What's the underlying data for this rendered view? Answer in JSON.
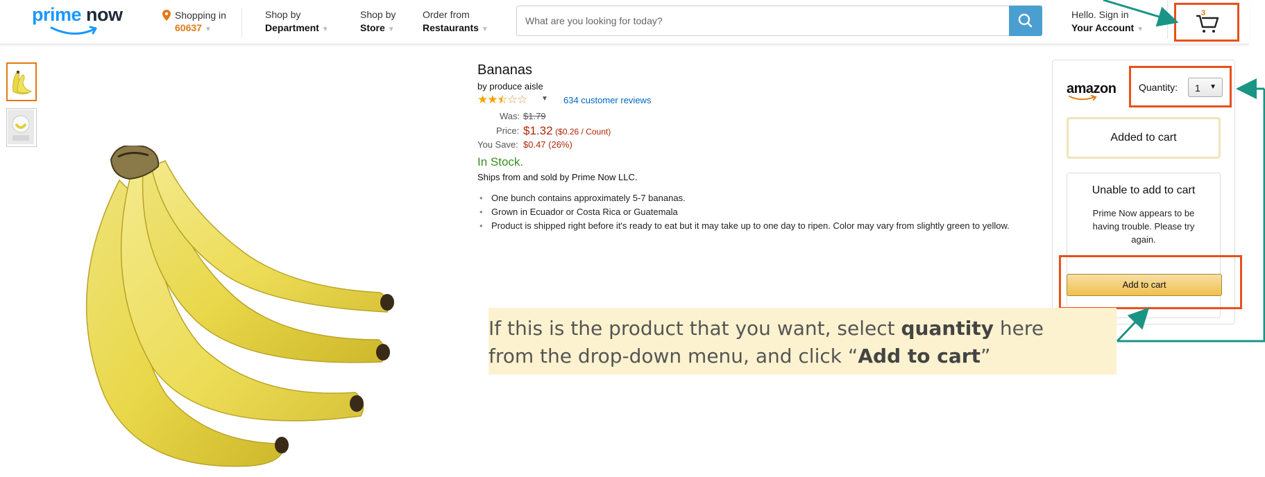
{
  "header": {
    "logo": {
      "prime": "prime",
      "now": "now"
    },
    "location": {
      "label": "Shopping in",
      "zip": "60637"
    },
    "nav": [
      {
        "line1": "Shop by",
        "line2": "Department"
      },
      {
        "line1": "Shop by",
        "line2": "Store"
      },
      {
        "line1": "Order from",
        "line2": "Restaurants"
      }
    ],
    "search": {
      "placeholder": "What are you looking for today?"
    },
    "account": {
      "line1": "Hello. Sign in",
      "line2": "Your Account"
    },
    "cart": {
      "count": "3"
    }
  },
  "product": {
    "title": "Bananas",
    "by": "by produce aisle",
    "rating": {
      "stars": 2.5,
      "reviews": "634 customer reviews"
    },
    "was_label": "Was:",
    "was": "$1.79",
    "price_label": "Price:",
    "price": "$1.32",
    "per_unit": "($0.26 / Count)",
    "save_label": "You Save:",
    "save": "$0.47 (26%)",
    "stock": "In Stock.",
    "ships": "Ships from and sold by Prime Now LLC.",
    "bullets": [
      "One bunch contains approximately 5-7 bananas.",
      "Grown in Ecuador or Costa Rica or Guatemala",
      "Product is shipped right before it's ready to eat but it may take up to one day to ripen. Color may vary from slightly green to yellow."
    ]
  },
  "buybox": {
    "brand": "amazon",
    "quantity_label": "Quantity:",
    "quantity_value": "1",
    "added": "Added to cart",
    "unable_title": "Unable to add to cart",
    "unable_msg": "Prime Now appears to be having trouble. Please try again.",
    "add_button": "Add to cart"
  },
  "annotation": {
    "line1_a": "If this is the product that you want, select ",
    "line1_b": "quantity",
    "line1_c": " here",
    "line2_a": "from the drop-down menu, and click “",
    "line2_b": "Add to cart",
    "line2_c": "”"
  },
  "colors": {
    "accent_orange": "#e47911",
    "highlight": "#e8501a",
    "arrow": "#1a9485",
    "link": "#0066c0",
    "price_red": "#b12704",
    "stock_green": "#388e1f"
  }
}
